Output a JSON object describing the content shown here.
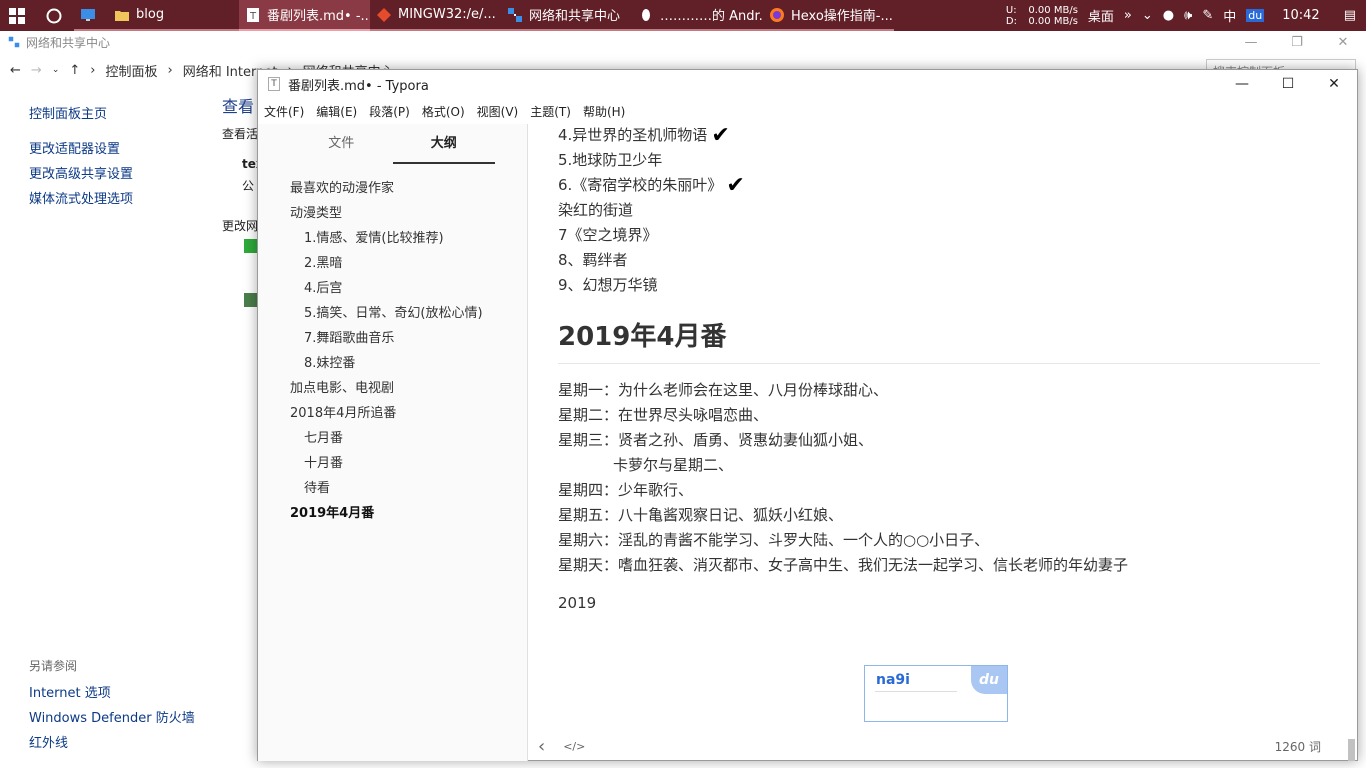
{
  "taskbar": {
    "tasks": [
      {
        "label": ""
      },
      {
        "label": "blog"
      },
      {
        "label": "番剧列表.md• -..."
      },
      {
        "label": "MINGW32:/e/..."
      },
      {
        "label": "网络和共享中心"
      },
      {
        "label": "…………的 Andr..."
      },
      {
        "label": "Hexo操作指南-..."
      }
    ],
    "net_up_label": "U:",
    "net_up": "0.00 MB/s",
    "net_down_label": "D:",
    "net_down": "0.00 MB/s",
    "desktop_label": "桌面",
    "expand_label": "»",
    "ime_lang": "中",
    "ime_brand": "du",
    "clock": "10:42",
    "accent_color": "#611f27"
  },
  "control_panel": {
    "title": "网络和共享中心",
    "breadcrumb": [
      "控制面板",
      "网络和 Internet",
      "网络和共享中心"
    ],
    "search_placeholder": "搜索控制面板",
    "left_links": [
      "控制面板主页",
      "更改适配器设置",
      "更改高级共享设置",
      "媒体流式处理选项"
    ],
    "see_also_header": "另请参阅",
    "see_also": [
      "Internet 选项",
      "Windows Defender 防火墙",
      "红外线"
    ],
    "main_title": "查看",
    "main_sub": "查看活",
    "main_item1": "tex",
    "main_item2": "公",
    "main_change": "更改网"
  },
  "typora": {
    "title": "番剧列表.md• - Typora",
    "menu": [
      "文件(F)",
      "编辑(E)",
      "段落(P)",
      "格式(O)",
      "视图(V)",
      "主题(T)",
      "帮助(H)"
    ],
    "tabs": {
      "files": "文件",
      "outline": "大纲"
    },
    "outline": [
      {
        "text": "最喜欢的动漫作家",
        "level": 1
      },
      {
        "text": "动漫类型",
        "level": 1
      },
      {
        "text": "1.情感、爱情(比较推荐)",
        "level": 2
      },
      {
        "text": "2.黑暗",
        "level": 2
      },
      {
        "text": "4.后宫",
        "level": 2
      },
      {
        "text": "5.搞笑、日常、奇幻(放松心情)",
        "level": 2
      },
      {
        "text": "7.舞蹈歌曲音乐",
        "level": 2
      },
      {
        "text": "8.妹控番",
        "level": 2
      },
      {
        "text": "加点电影、电视剧",
        "level": 1
      },
      {
        "text": "2018年4月所追番",
        "level": 1
      },
      {
        "text": "七月番",
        "level": 2
      },
      {
        "text": "十月番",
        "level": 2
      },
      {
        "text": "待看",
        "level": 2
      },
      {
        "text": "2019年4月番",
        "level": 1,
        "active": true
      }
    ],
    "doc": {
      "list_top": [
        {
          "text": "4.异世界的圣机师物语",
          "check": "✔"
        },
        {
          "text": "5.地球防卫少年",
          "check": ""
        },
        {
          "text": "6.《寄宿学校的朱丽叶》",
          "check": "✔"
        },
        {
          "text": "染红的街道",
          "check": ""
        },
        {
          "text": "7《空之境界》",
          "check": ""
        },
        {
          "text": "8、羁绊者",
          "check": ""
        },
        {
          "text": "9、幻想万华镜",
          "check": ""
        }
      ],
      "heading": "2019年4月番",
      "schedule": [
        "星期一：为什么老师会在这里、八月份棒球甜心、",
        "星期二：在世界尽头咏唱恋曲、",
        "星期三：贤者之孙、盾勇、贤惠幼妻仙狐小姐、",
        "卡萝尔与星期二、",
        "星期四：少年歌行、",
        "星期五：八十亀酱观察日记、狐妖小红娘、",
        "星期六：淫乱的青酱不能学习、斗罗大陆、一个人的○○小日子、",
        "星期天：嗜血狂袭、消灭都市、女子高中生、我们无法一起学习、信长老师的年幼妻子"
      ],
      "year_line": "2019"
    },
    "ime": {
      "input": "na9i",
      "logo": "du"
    },
    "footer": {
      "back": "‹",
      "source": "</>",
      "word_count": "1260 词"
    }
  }
}
